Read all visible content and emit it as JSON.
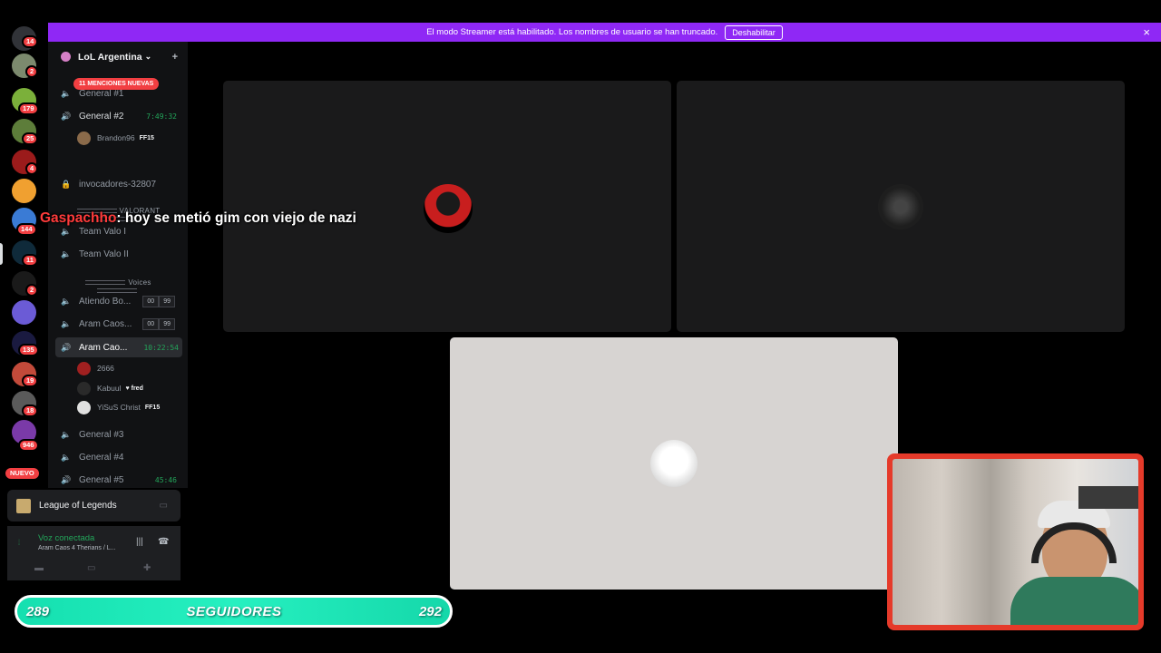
{
  "banner": {
    "text": "El modo Streamer está habilitado. Los nombres de usuario se han truncado.",
    "button": "Deshabilitar",
    "close_icon": "×"
  },
  "rail": {
    "badges": [
      "14",
      "2",
      "179",
      "25",
      "4",
      "144",
      "11",
      "2",
      "135",
      "19",
      "18",
      "946"
    ],
    "new_label": "NUEVO"
  },
  "server": {
    "name": "LoL Argentina",
    "chevron": "⌄",
    "mentions_pill": "11 MENCIONES NUEVAS"
  },
  "channels": {
    "general1": "General #1",
    "general2": "General #2",
    "general2_time": "7:49:32",
    "user_brandon": "Brandon96",
    "tag_ff15": "FF15",
    "invocadores": "invocadores-32807",
    "valorant_cat": "VALORANT",
    "team_valo_1": "Team Valo I",
    "team_valo_2": "Team Valo II",
    "voices_cat": "Voices",
    "atiendo": "Atiendo Bo...",
    "aram_caos_1": "Aram Caos...",
    "pill_00": "00",
    "pill_99": "99",
    "aram_caos_active": "Aram Cao...",
    "active_time": "10:22:54",
    "user_2666": "2666",
    "user_kabuul": "Kabuul",
    "tag_fred": "fred",
    "user_yisus": "YiSuS Christ",
    "general3": "General #3",
    "general4": "General #4",
    "general5": "General #5",
    "general5_time": "45:46"
  },
  "activity": {
    "game": "League of Legends"
  },
  "voice": {
    "status": "Voz conectada",
    "channel": "Aram Caos 4 Therians / L..."
  },
  "chat_overlay": {
    "name": "Gaspachho",
    "message": ": hoy se metió gim con viejo de nazi"
  },
  "followers": {
    "current": "289",
    "label": "SEGUIDORES",
    "goal": "292"
  },
  "colors": {
    "streamer_banner": "#8f28f5",
    "voice_green": "#23a55a",
    "mention_red": "#f23f42",
    "follower_bar": "#26f0c0",
    "webcam_border": "#e53a2a"
  }
}
